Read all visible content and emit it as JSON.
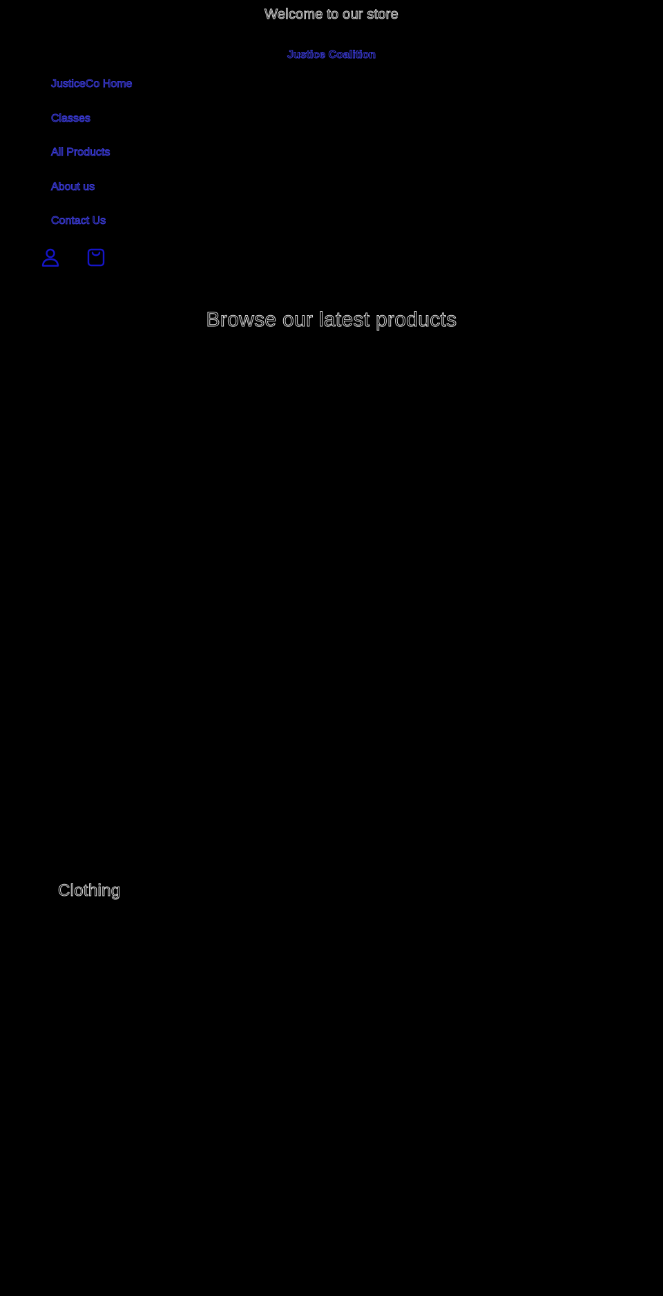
{
  "announcement": {
    "text": "Welcome to our store"
  },
  "header": {
    "store_name": "Justice Coalition",
    "menu": [
      {
        "label": "JusticeCo Home"
      },
      {
        "label": "Classes"
      },
      {
        "label": "All Products"
      },
      {
        "label": "About us"
      },
      {
        "label": "Contact Us"
      }
    ],
    "icons": {
      "account": "account-icon",
      "cart": "cart-icon"
    }
  },
  "main": {
    "hero_title": "Browse our latest products",
    "collection_title": "Clothing"
  },
  "colors": {
    "background": "#000000",
    "text_outline": "#d9d9d9",
    "link_outline": "#3b3bd9",
    "icon": "#1515c8"
  }
}
